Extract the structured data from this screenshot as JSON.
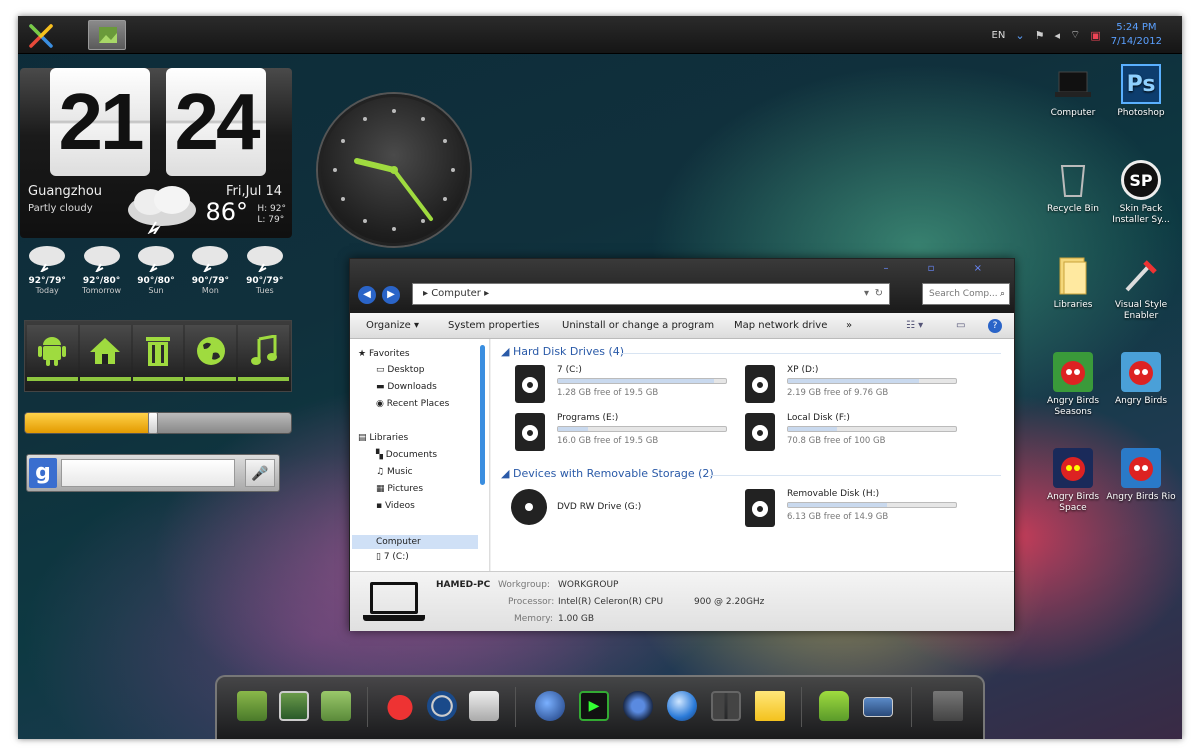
{
  "topbar": {
    "language": "EN",
    "time": "5:24 PM",
    "date": "7/14/2012"
  },
  "weather": {
    "hour": "21",
    "minute": "24",
    "city": "Guangzhou",
    "condition": "Partly cloudy",
    "date": "Fri,Jul 14",
    "temperature": "86°",
    "high": "H: 92°",
    "low": "L: 79°",
    "forecast": [
      {
        "temps": "92°/79°",
        "day": "Today"
      },
      {
        "temps": "92°/80°",
        "day": "Tomorrow"
      },
      {
        "temps": "90°/80°",
        "day": "Sun"
      },
      {
        "temps": "90°/79°",
        "day": "Mon"
      },
      {
        "temps": "90°/79°",
        "day": "Tues"
      }
    ]
  },
  "launcher": {
    "icons": [
      "android-icon",
      "home-icon",
      "trash-icon",
      "globe-icon",
      "music-icon"
    ]
  },
  "volume": {
    "level": 0.48
  },
  "google": {
    "logo": "g"
  },
  "desktop_icons": [
    {
      "label": "Computer",
      "icon": "laptop-icon"
    },
    {
      "label": "Photoshop",
      "icon": "photoshop-icon",
      "glyph": "Ps"
    },
    {
      "label": "Recycle Bin",
      "icon": "recycle-bin-icon"
    },
    {
      "label": "Skin Pack Installer Sy...",
      "icon": "skinpack-icon",
      "glyph": "SP"
    },
    {
      "label": "Libraries",
      "icon": "folder-icon"
    },
    {
      "label": "Visual Style Enabler",
      "icon": "visual-style-icon"
    },
    {
      "label": "Angry Birds Seasons",
      "icon": "angry-birds-icon"
    },
    {
      "label": "Angry Birds",
      "icon": "angry-birds-icon"
    },
    {
      "label": "Angry Birds Space",
      "icon": "angry-birds-space-icon"
    },
    {
      "label": "Angry Birds Rio",
      "icon": "angry-birds-rio-icon"
    }
  ],
  "explorer": {
    "window_buttons": "– ▫ ×",
    "address": "▸ Computer ▸",
    "search_placeholder": "Search Comp...",
    "toolbar": {
      "organize": "Organize ▾",
      "system_properties": "System properties",
      "uninstall": "Uninstall or change a program",
      "map_drive": "Map network drive",
      "more": "»"
    },
    "nav": {
      "favorites": "Favorites",
      "desktop": "Desktop",
      "downloads": "Downloads",
      "recent": "Recent Places",
      "libraries": "Libraries",
      "documents": "Documents",
      "music": "Music",
      "pictures": "Pictures",
      "videos": "Videos",
      "computer": "Computer",
      "drive_c": "7 (C:)"
    },
    "group_hdd": "Hard Disk Drives (4)",
    "group_removable": "Devices with Removable Storage (2)",
    "drives": [
      {
        "name": "7 (C:)",
        "free": "1.28 GB free of 19.5 GB",
        "used": 0.93
      },
      {
        "name": "XP (D:)",
        "free": "2.19 GB free of 9.76 GB",
        "used": 0.78
      },
      {
        "name": "Programs (E:)",
        "free": "16.0 GB free of 19.5 GB",
        "used": 0.18
      },
      {
        "name": "Local Disk (F:)",
        "free": "70.8 GB free of 100 GB",
        "used": 0.29
      }
    ],
    "dvd": {
      "name": "DVD RW Drive (G:)"
    },
    "removable": {
      "name": "Removable Disk (H:)",
      "free": "6.13 GB free of 14.9 GB",
      "used": 0.59
    },
    "details": {
      "pc_name": "HAMED-PC",
      "workgroup_label": "Workgroup:",
      "workgroup": "WORKGROUP",
      "processor_label": "Processor:",
      "processor": "Intel(R) Celeron(R) CPU",
      "speed": "900  @ 2.20GHz",
      "memory_label": "Memory:",
      "memory": "1.00 GB"
    }
  }
}
